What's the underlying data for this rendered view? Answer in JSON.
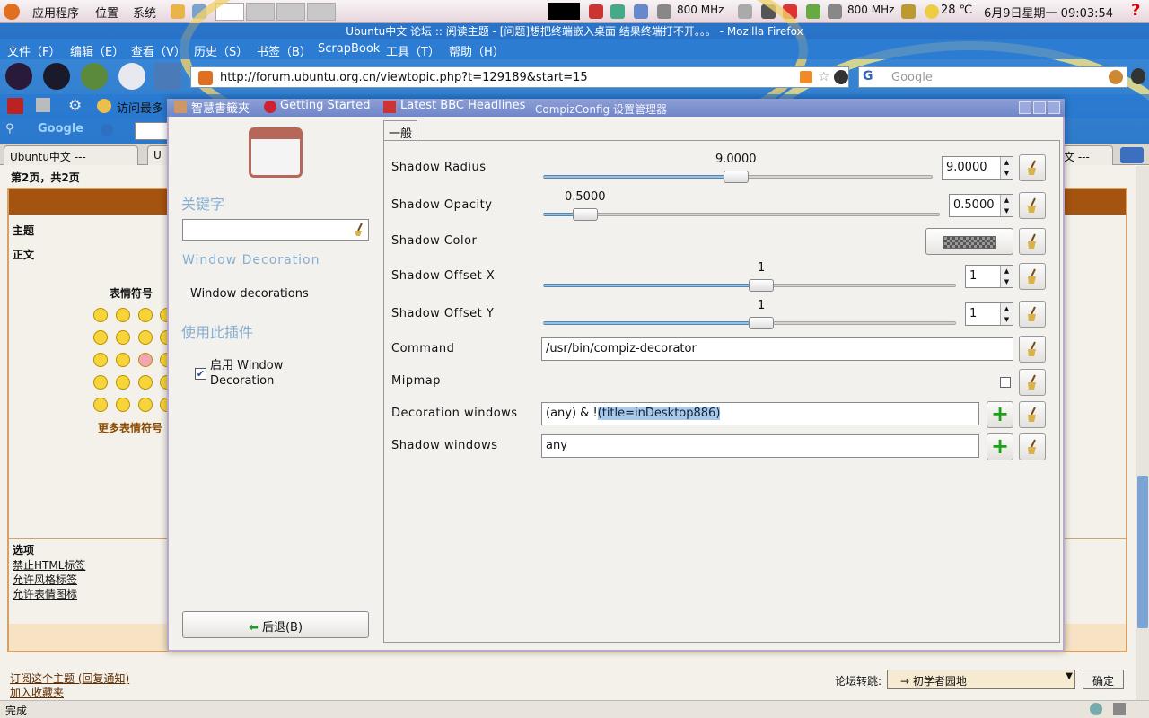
{
  "panel": {
    "menu_apps": "应用程序",
    "menu_places": "位置",
    "menu_system": "系统",
    "cpu1": "800 MHz",
    "cpu2": "800 MHz",
    "weather": "28 ℃",
    "datetime": "6月9日星期一 09:03:54"
  },
  "firefox": {
    "title": "Ubuntu中文 论坛 :: 阅读主题 - [问题]想把终端嵌入桌面 结果终端打不开。。。 - Mozilla Firefox",
    "menu": [
      "文件（F）",
      "编辑（E）",
      "查看（V）",
      "历史（S）",
      "书签（B）",
      "ScrapBook",
      "工具（T）",
      "帮助（H）"
    ],
    "url": "http://forum.ubuntu.org.cn/viewtopic.php?t=129189&start=15",
    "search_placeholder": "Google",
    "bookmarks": [
      "访问最多",
      "智慧書籤夾",
      "Getting Started",
      "Latest BBC Headlines"
    ],
    "google_toolbar": "Google",
    "tab_title": "Ubuntu中文 ---",
    "tab_title_2": "U",
    "tab_title_right": "文 ---",
    "status": "完成"
  },
  "page": {
    "pages": "第2页，共2页",
    "subject_label": "主题",
    "body_label": "正文",
    "smilies_title": "表情符号",
    "more_smilies": "更多表情符号",
    "options_title": "选项",
    "options": [
      "禁止HTML标签",
      "允许风格标签",
      "允许表情图标"
    ],
    "links": [
      "订阅这个主题 (回复通知)",
      "加入收藏夹"
    ],
    "jump_label": "论坛转跳:",
    "jump_value": "→ 初学者园地",
    "ok_button": "确定"
  },
  "dialog": {
    "title": "CompizConfig 设置管理器",
    "keyword_label": "关键字",
    "search_value": "",
    "plugin_name": "Window Decoration",
    "plugin_desc": "Window decorations",
    "use_plugin_label": "使用此插件",
    "enable_label": "启用 Window Decoration",
    "enable_checked": true,
    "back_button": "后退(B)",
    "tab": "一般",
    "settings": {
      "shadow_radius": {
        "label": "Shadow Radius",
        "value": "9.0000",
        "fraction": 0.5
      },
      "shadow_opacity": {
        "label": "Shadow Opacity",
        "value": "0.5000",
        "fraction": 0.1
      },
      "shadow_color": {
        "label": "Shadow Color"
      },
      "shadow_offset_x": {
        "label": "Shadow Offset X",
        "value": "1",
        "fraction": 0.52
      },
      "shadow_offset_y": {
        "label": "Shadow Offset Y",
        "value": "1",
        "fraction": 0.52
      },
      "command": {
        "label": "Command",
        "value": "/usr/bin/compiz-decorator"
      },
      "mipmap": {
        "label": "Mipmap",
        "checked": false
      },
      "decoration_windows": {
        "label": "Decoration windows",
        "prefix": "(any) & !",
        "selected": "(title=inDesktop886)"
      },
      "shadow_windows": {
        "label": "Shadow windows",
        "value": "any"
      }
    }
  }
}
